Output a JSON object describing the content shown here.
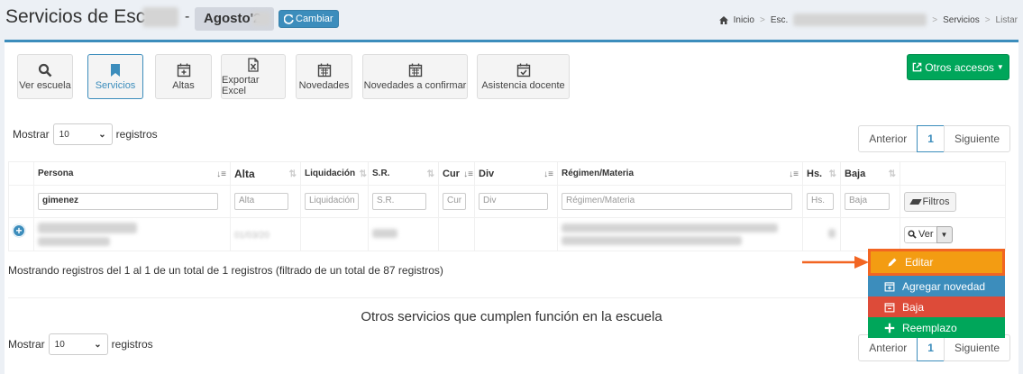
{
  "header": {
    "title": "Servicios de Esc.",
    "dash": "-",
    "period": "Agosto'2",
    "change_button": "Cambiar"
  },
  "breadcrumb": {
    "home": "Inicio",
    "school": "Esc.",
    "section": "Servicios",
    "current": "Listar"
  },
  "toolbar": {
    "buttons": [
      {
        "label": "Ver escuela",
        "icon": "search-icon"
      },
      {
        "label": "Servicios",
        "icon": "bookmark-icon"
      },
      {
        "label": "Altas",
        "icon": "calendar-plus-icon"
      },
      {
        "label": "Exportar Excel",
        "icon": "excel-file-icon"
      },
      {
        "label": "Novedades",
        "icon": "calendar-icon"
      },
      {
        "label": "Novedades a confirmar",
        "icon": "calendar-icon"
      },
      {
        "label": "Asistencia docente",
        "icon": "calendar-check-icon"
      }
    ],
    "other_access": "Otros accesos"
  },
  "table1": {
    "length_prefix": "Mostrar",
    "length_value": "10",
    "length_suffix": "registros",
    "pager": {
      "prev": "Anterior",
      "page": "1",
      "next": "Siguiente"
    },
    "columns": [
      "Persona",
      "Alta",
      "Liquidación",
      "S.R.",
      "Cur",
      "Div",
      "Régimen/Materia",
      "Hs.",
      "Baja"
    ],
    "filters": {
      "persona": "gimenez",
      "alta": "Alta",
      "liquidacion": "Liquidación",
      "sr": "S.R.",
      "cur": "Cur",
      "div": "Div",
      "regimen": "Régimen/Materia",
      "hs": "Hs.",
      "baja": "Baja",
      "filtros_button": "Filtros"
    },
    "row": {
      "alta": "01/03/20",
      "ver_button": "Ver"
    },
    "info": "Mostrando registros del 1 al 1 de un total de 1 registros (filtrado de un total de 87 registros)"
  },
  "actions_menu": {
    "items": [
      {
        "label": "Editar",
        "icon": "pencil-icon"
      },
      {
        "label": "Agregar novedad",
        "icon": "calendar-plus-icon"
      },
      {
        "label": "Baja",
        "icon": "calendar-minus-icon"
      },
      {
        "label": "Reemplazo",
        "icon": "plus-icon"
      }
    ]
  },
  "section2": {
    "title": "Otros servicios que cumplen función en la escuela",
    "length_prefix": "Mostrar",
    "length_value": "10",
    "length_suffix": "registros",
    "pager": {
      "prev": "Anterior",
      "page": "1",
      "next": "Siguiente"
    }
  },
  "colors": {
    "primary": "#3c8dbc",
    "success": "#00a65a",
    "warning": "#f39c12",
    "danger": "#dd4b39",
    "highlight": "#f26522"
  }
}
